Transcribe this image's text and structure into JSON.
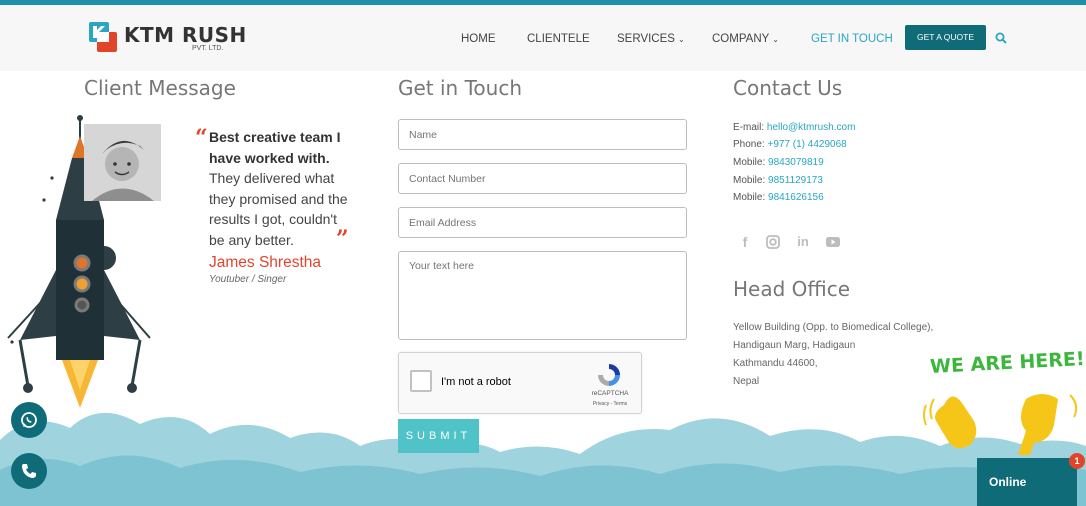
{
  "header": {
    "logo_name": "KTM RUSH",
    "logo_sub": "PVT. LTD.",
    "nav": [
      {
        "label": "HOME"
      },
      {
        "label": "CLIENTELE"
      },
      {
        "label": "SERVICES"
      },
      {
        "label": "COMPANY"
      },
      {
        "label": "GET IN TOUCH",
        "active": true
      }
    ],
    "quote_button": "GET A QUOTE",
    "accent": "#2aa5c2",
    "brand_dark": "#0f6b77"
  },
  "client_message": {
    "title": "Client Message",
    "quote_bold": "Best creative team I have worked with.",
    "quote_rest": "They delivered what they promised and the results I got, couldn't be any better.",
    "name": "James Shrestha",
    "role": "Youtuber / Singer",
    "quote_color": "#e0452a"
  },
  "get_in_touch": {
    "title": "Get in Touch",
    "name_placeholder": "Name",
    "phone_placeholder": "Contact Number",
    "email_placeholder": "Email Address",
    "message_placeholder": "Your text here",
    "recaptcha_label": "I'm not a robot",
    "recaptcha_brand": "reCAPTCHA",
    "recaptcha_links": "Privacy - Terms",
    "submit_label": "SUBMIT",
    "submit_color": "#4fc3c8"
  },
  "contact_us": {
    "title": "Contact Us",
    "lines": [
      {
        "label": "E-mail: ",
        "value": "hello@ktmrush.com"
      },
      {
        "label": "Phone: ",
        "value": "+977 (1) 4429068"
      },
      {
        "label": "Mobile: ",
        "value": "9843079819"
      },
      {
        "label": "Mobile: ",
        "value": "9851129173"
      },
      {
        "label": "Mobile: ",
        "value": "9841626156"
      }
    ],
    "social": [
      "facebook-icon",
      "instagram-icon",
      "linkedin-icon",
      "youtube-icon"
    ]
  },
  "head_office": {
    "title": "Head Office",
    "lines": [
      "Yellow Building (Opp. to Biomedical College),",
      "Handigaun Marg, Hadigaun",
      "Kathmandu 44600,",
      "Nepal"
    ]
  },
  "widget": {
    "we_are_here": "WE ARE HERE!",
    "online_label": "Online",
    "badge_count": "1"
  }
}
